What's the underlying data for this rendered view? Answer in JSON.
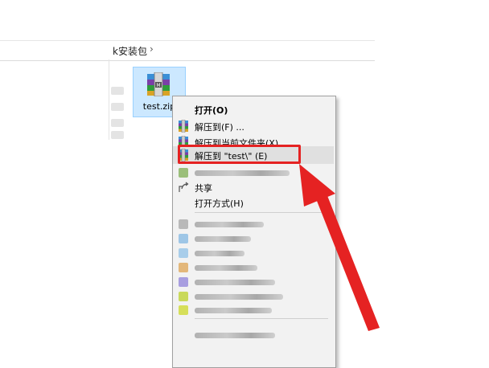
{
  "address": {
    "path": "k安装包",
    "chevron": "›"
  },
  "file": {
    "name": "test.zip"
  },
  "menu": {
    "open": "打开(O)",
    "extract_to": "解压到(F) ...",
    "extract_here": "解压到当前文件夹(X)",
    "extract_to_test": "解压到 \"test\\\" (E)",
    "share": "共享",
    "open_with": "打开方式(H)"
  },
  "colors": {
    "highlight": "#e52222",
    "selection": "#cce8ff",
    "menu_bg": "#f2f2f2"
  }
}
